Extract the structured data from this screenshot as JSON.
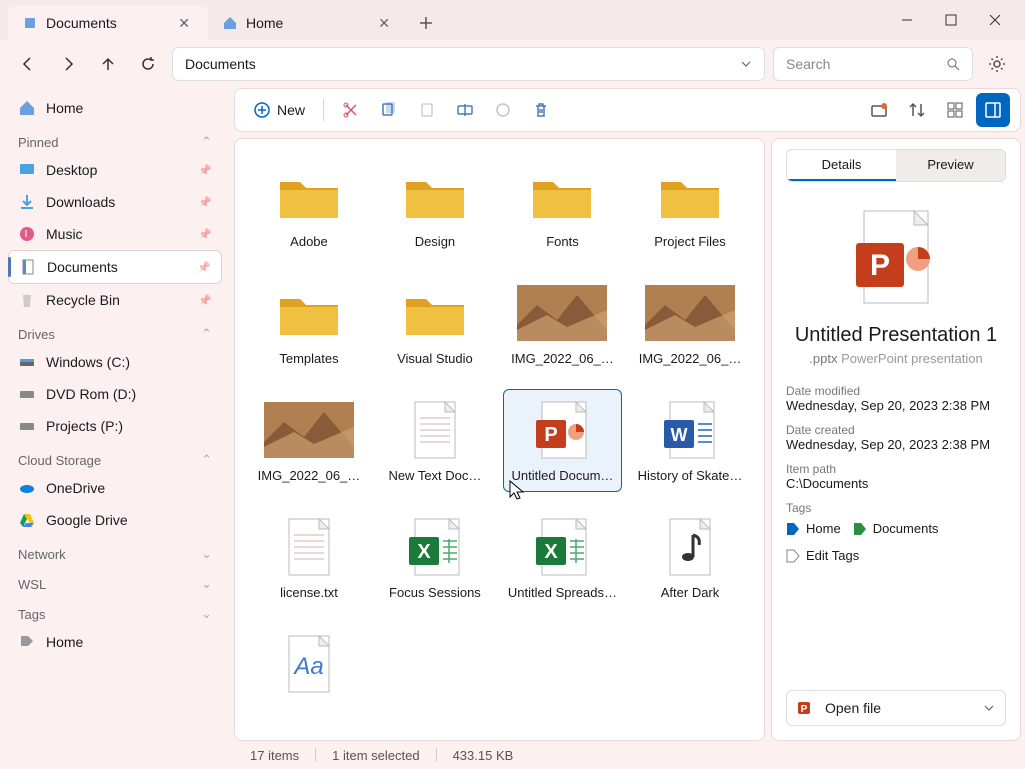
{
  "tabs": [
    {
      "title": "Documents",
      "active": true
    },
    {
      "title": "Home",
      "active": false
    }
  ],
  "addressbar": {
    "path": "Documents"
  },
  "searchbar": {
    "placeholder": "Search"
  },
  "sidebar": {
    "home_label": "Home",
    "pinned_header": "Pinned",
    "pinned": [
      {
        "label": "Desktop"
      },
      {
        "label": "Downloads"
      },
      {
        "label": "Music"
      },
      {
        "label": "Documents",
        "selected": true
      },
      {
        "label": "Recycle Bin"
      }
    ],
    "drives_header": "Drives",
    "drives": [
      {
        "label": "Windows (C:)"
      },
      {
        "label": "DVD Rom (D:)"
      },
      {
        "label": "Projects (P:)"
      }
    ],
    "cloud_header": "Cloud Storage",
    "cloud": [
      {
        "label": "OneDrive"
      },
      {
        "label": "Google Drive"
      }
    ],
    "network_header": "Network",
    "wsl_header": "WSL",
    "tags_header": "Tags",
    "tags": [
      {
        "label": "Home"
      }
    ]
  },
  "action_bar": {
    "new_label": "New"
  },
  "files": [
    {
      "name": "Adobe",
      "type": "folder"
    },
    {
      "name": "Design",
      "type": "folder"
    },
    {
      "name": "Fonts",
      "type": "folder"
    },
    {
      "name": "Project Files",
      "type": "folder"
    },
    {
      "name": "Templates",
      "type": "folder"
    },
    {
      "name": "Visual Studio",
      "type": "folder"
    },
    {
      "name": "IMG_2022_06_…",
      "type": "image"
    },
    {
      "name": "IMG_2022_06_…",
      "type": "image"
    },
    {
      "name": "IMG_2022_06_…",
      "type": "image"
    },
    {
      "name": "New Text Doc…",
      "type": "text"
    },
    {
      "name": "Untitled Docum…",
      "type": "pptx",
      "selected": true
    },
    {
      "name": "History of Skate…",
      "type": "docx"
    },
    {
      "name": "license.txt",
      "type": "text"
    },
    {
      "name": "Focus Sessions",
      "type": "xlsx"
    },
    {
      "name": "Untitled Spreads…",
      "type": "xlsx"
    },
    {
      "name": "After Dark",
      "type": "audio"
    },
    {
      "name": "",
      "type": "font"
    }
  ],
  "details": {
    "tab_details": "Details",
    "tab_preview": "Preview",
    "title": "Untitled Presentation 1",
    "ext": ".pptx",
    "type_label": "PowerPoint presentation",
    "date_modified_label": "Date modified",
    "date_modified": "Wednesday, Sep 20, 2023 2:38 PM",
    "date_created_label": "Date created",
    "date_created": "Wednesday, Sep 20, 2023 2:38 PM",
    "path_label": "Item path",
    "path": "C:\\Documents",
    "tags_label": "Tags",
    "tag_home": "Home",
    "tag_documents": "Documents",
    "edit_tags": "Edit Tags",
    "open_label": "Open file"
  },
  "status": {
    "items": "17 items",
    "selected": "1 item selected",
    "size": "433.15 KB"
  }
}
